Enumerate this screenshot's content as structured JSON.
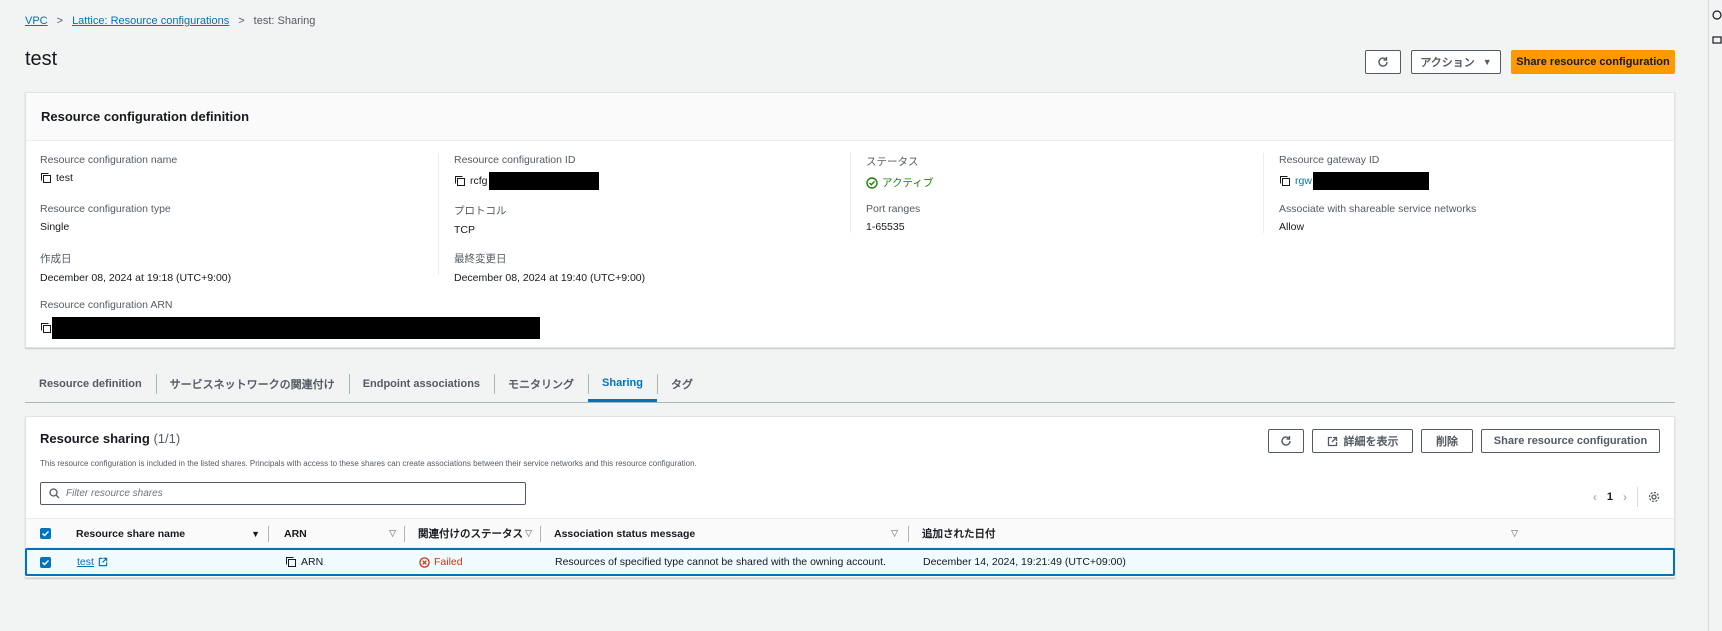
{
  "breadcrumb": {
    "items": [
      "VPC",
      "Lattice: Resource configurations",
      "test: Sharing"
    ]
  },
  "page": {
    "title": "test"
  },
  "header_buttons": {
    "refresh": "refresh-icon",
    "actions": "アクション",
    "share": "Share resource configuration"
  },
  "definition": {
    "heading": "Resource configuration definition",
    "fields": {
      "name": {
        "label": "Resource configuration name",
        "value": "test"
      },
      "id": {
        "label": "Resource configuration ID",
        "value": "rcfg"
      },
      "status": {
        "label": "ステータス",
        "value": "アクティブ"
      },
      "gateway": {
        "label": "Resource gateway ID",
        "value": "rgw"
      },
      "type": {
        "label": "Resource configuration type",
        "value": "Single"
      },
      "protocol": {
        "label": "プロトコル",
        "value": "TCP"
      },
      "ports": {
        "label": "Port ranges",
        "value": "1-65535"
      },
      "assoc": {
        "label": "Associate with shareable service networks",
        "value": "Allow"
      },
      "created": {
        "label": "作成日",
        "value": "December 08, 2024 at 19:18 (UTC+9:00)"
      },
      "modified": {
        "label": "最終変更日",
        "value": "December 08, 2024 at 19:40 (UTC+9:00)"
      },
      "arn": {
        "label": "Resource configuration ARN",
        "value": ""
      }
    }
  },
  "tabs": [
    "Resource definition",
    "サービスネットワークの関連付け",
    "Endpoint associations",
    "モニタリング",
    "Sharing",
    "タグ"
  ],
  "sharing": {
    "title": "Resource sharing",
    "count": "(1/1)",
    "description": "This resource configuration is included in the listed shares. Principals with access to these shares can create associations between their service networks and this resource configuration.",
    "buttons": {
      "details": "詳細を表示",
      "delete": "削除",
      "share": "Share resource configuration"
    },
    "filter_placeholder": "Filter resource shares",
    "page": "1",
    "columns": [
      "Resource share name",
      "ARN",
      "関連付けのステータス",
      "Association status message",
      "追加された日付"
    ],
    "rows": [
      {
        "name": "test",
        "arn": "ARN",
        "status": "Failed",
        "message": "Resources of specified type cannot be shared with the owning account.",
        "date": "December 14, 2024, 19:21:49 (UTC+09:00)"
      }
    ]
  },
  "colors": {
    "link": "#0073bb",
    "primary": "#ff9900",
    "success": "#1d8102",
    "error": "#d13212"
  }
}
